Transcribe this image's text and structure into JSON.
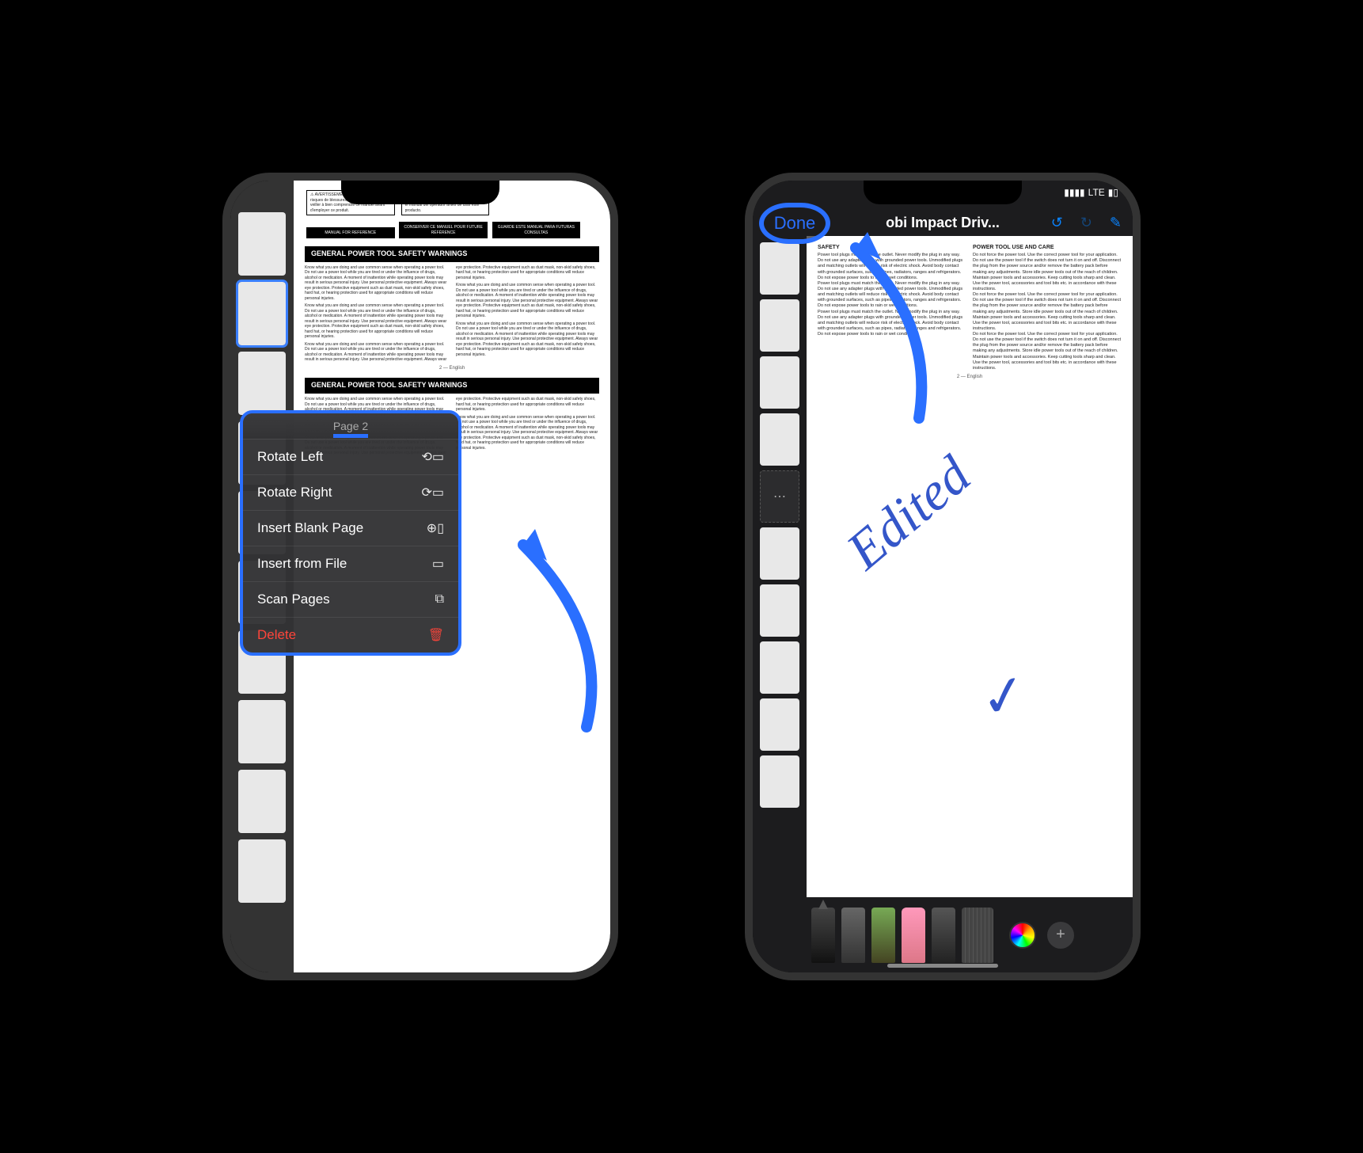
{
  "phone1": {
    "context_menu": {
      "header": "Page 2",
      "items": [
        {
          "label": "Rotate Left",
          "icon": "⟲▭"
        },
        {
          "label": "Rotate Right",
          "icon": "⟳▭"
        },
        {
          "label": "Insert Blank Page",
          "icon": "⊕▯"
        },
        {
          "label": "Insert from File",
          "icon": "▭"
        },
        {
          "label": "Scan Pages",
          "icon": "⧉"
        },
        {
          "label": "Delete",
          "icon": "🗑",
          "destructive": true
        }
      ]
    },
    "document": {
      "warn_box_1": "⚠ AVERTISSEMENT : Pour réduire les risques de blessures, l'utilisateur doit lire et veiller à bien comprendre ce manuel avant d'employer ce produit.",
      "warn_box_2": "⚠ ADVERTENCIA: Para reducir el riesgo de lesiones, el usuario debe leer y comprender el manual del operador antes de usar este producto.",
      "black_box_1": "MANUAL FOR REFERENCE",
      "black_box_2": "CONSERVER CE MANUEL POUR FUTURE RÉFÉRENCE",
      "black_box_3": "GUARDE ESTE MANUAL PARA FUTURAS CONSULTAS",
      "heading_a": "GENERAL POWER TOOL SAFETY WARNINGS",
      "heading_b": "GENERAL POWER TOOL SAFETY WARNINGS",
      "page_marker": "2 — English",
      "body_sample": "Know what you are doing and use common sense when operating a power tool. Do not use a power tool while you are tired or under the influence of drugs, alcohol or medication. A moment of inattention while operating power tools may result in serious personal injury. Use personal protective equipment. Always wear eye protection. Protective equipment such as dust mask, non-skid safety shoes, hard hat, or hearing protection used for appropriate conditions will reduce personal injuries."
    }
  },
  "phone2": {
    "status": {
      "signal": "▮▮▮▮",
      "network": "LTE",
      "battery": "▮▯"
    },
    "done_label": "Done",
    "title": "obi Impact Driv...",
    "toolbar_icons": {
      "undo": "↺",
      "redo": "↻",
      "markup": "✎"
    },
    "document": {
      "heading_safety": "SAFETY",
      "heading_use": "POWER TOOL USE AND CARE",
      "page_marker": "2 — English",
      "handwriting": "Edited",
      "checkmark": "✓",
      "body_sample_left": "Power tool plugs must match the outlet. Never modify the plug in any way. Do not use any adapter plugs with grounded power tools. Unmodified plugs and matching outlets will reduce risk of electric shock. Avoid body contact with grounded surfaces, such as pipes, radiators, ranges and refrigerators. Do not expose power tools to rain or wet conditions.",
      "body_sample_right": "Do not force the power tool. Use the correct power tool for your application. Do not use the power tool if the switch does not turn it on and off. Disconnect the plug from the power source and/or remove the battery pack before making any adjustments. Store idle power tools out of the reach of children. Maintain power tools and accessories. Keep cutting tools sharp and clean. Use the power tool, accessories and tool bits etc. in accordance with these instructions."
    },
    "markup_tools": [
      "pen",
      "marker",
      "pencil",
      "eraser",
      "lasso",
      "ruler"
    ]
  }
}
